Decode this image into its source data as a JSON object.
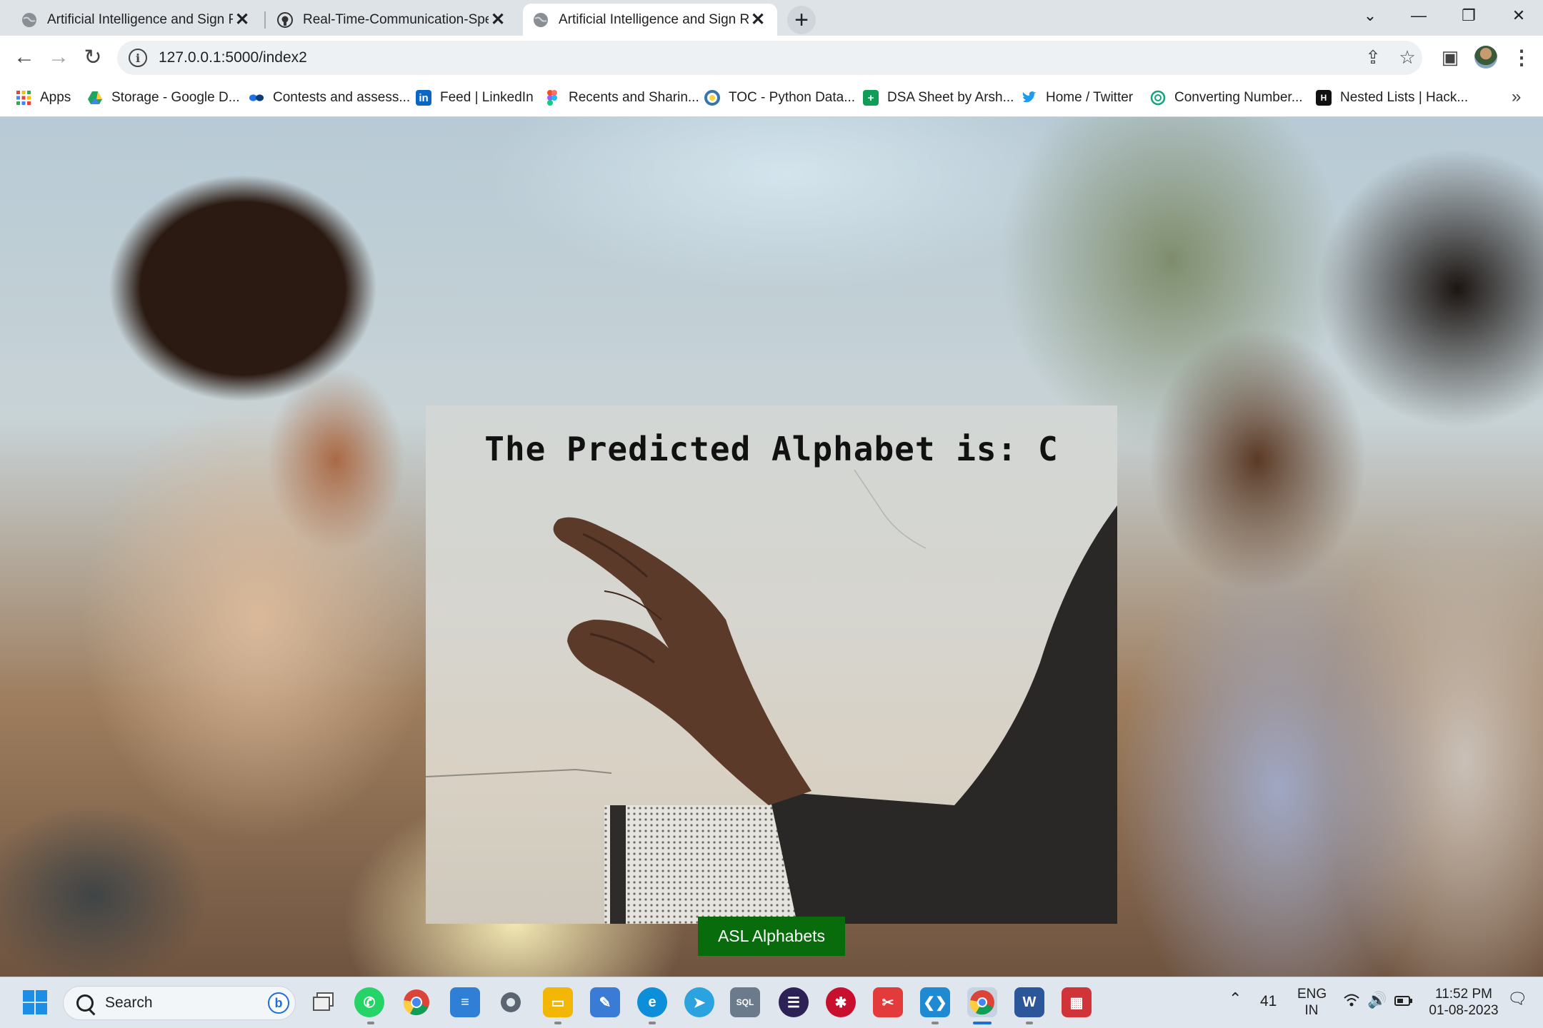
{
  "browser": {
    "tabs": [
      {
        "title": "Artificial Intelligence and Sign Re",
        "active": false
      },
      {
        "title": "Real-Time-Communication-Speci",
        "active": false
      },
      {
        "title": "Artificial Intelligence and Sign Re",
        "active": true
      }
    ],
    "url": "127.0.0.1:5000/index2",
    "bookmarks": [
      {
        "label": "Apps",
        "icon": "apps-grid-icon",
        "color": "#ea4335"
      },
      {
        "label": "Storage - Google D...",
        "icon": "google-drive-icon",
        "color": "#1fa463"
      },
      {
        "label": "Contests and assess...",
        "icon": "contests-icon",
        "color": "#1a73e8"
      },
      {
        "label": "Feed | LinkedIn",
        "icon": "linkedin-icon",
        "color": "#0a66c2"
      },
      {
        "label": "Recents and Sharin...",
        "icon": "figma-icon",
        "color": "#f24e1e"
      },
      {
        "label": "TOC - Python Data...",
        "icon": "python-icon",
        "color": "#3776ab"
      },
      {
        "label": "DSA Sheet by Arsh...",
        "icon": "sheets-icon",
        "color": "#0f9d58"
      },
      {
        "label": "Home / Twitter",
        "icon": "twitter-icon",
        "color": "#1d9bf0"
      },
      {
        "label": "Converting Number...",
        "icon": "chatgpt-icon",
        "color": "#10a37f"
      },
      {
        "label": "Nested Lists | Hack...",
        "icon": "hackerrank-icon",
        "color": "#111111"
      }
    ]
  },
  "page": {
    "prediction_text": "The Predicted Alphabet is: C",
    "button_label": "ASL Alphabets",
    "button_color": "#0b6b10"
  },
  "taskbar": {
    "search_placeholder": "Search",
    "apps": [
      {
        "icon": "task-view-icon",
        "color": "#7a7f86"
      },
      {
        "icon": "whatsapp-icon",
        "color": "#25d366"
      },
      {
        "icon": "chrome-icon",
        "color": "#db4437"
      },
      {
        "icon": "notepad-icon",
        "color": "#2f7fd6"
      },
      {
        "icon": "settings-icon",
        "color": "#5b6572"
      },
      {
        "icon": "file-explorer-icon",
        "color": "#f2b705"
      },
      {
        "icon": "notes-icon",
        "color": "#3a7bd5"
      },
      {
        "icon": "edge-icon",
        "color": "#0c8fd8"
      },
      {
        "icon": "telegram-icon",
        "color": "#2aa3df"
      },
      {
        "icon": "sql-developer-icon",
        "color": "#6b7b8c"
      },
      {
        "icon": "eclipse-icon",
        "color": "#2c2255"
      },
      {
        "icon": "mysql-workbench-icon",
        "color": "#c8102e"
      },
      {
        "icon": "snipping-icon",
        "color": "#e33b3b"
      },
      {
        "icon": "vscode-icon",
        "color": "#1f8ad2"
      },
      {
        "icon": "chrome-active-icon",
        "color": "#db4437"
      },
      {
        "icon": "word-icon",
        "color": "#2b579a"
      },
      {
        "icon": "paint-icon",
        "color": "#d13438"
      }
    ],
    "tray": {
      "temperature": "41",
      "language_line1": "ENG",
      "language_line2": "IN",
      "time": "11:52 PM",
      "date": "01-08-2023"
    }
  }
}
